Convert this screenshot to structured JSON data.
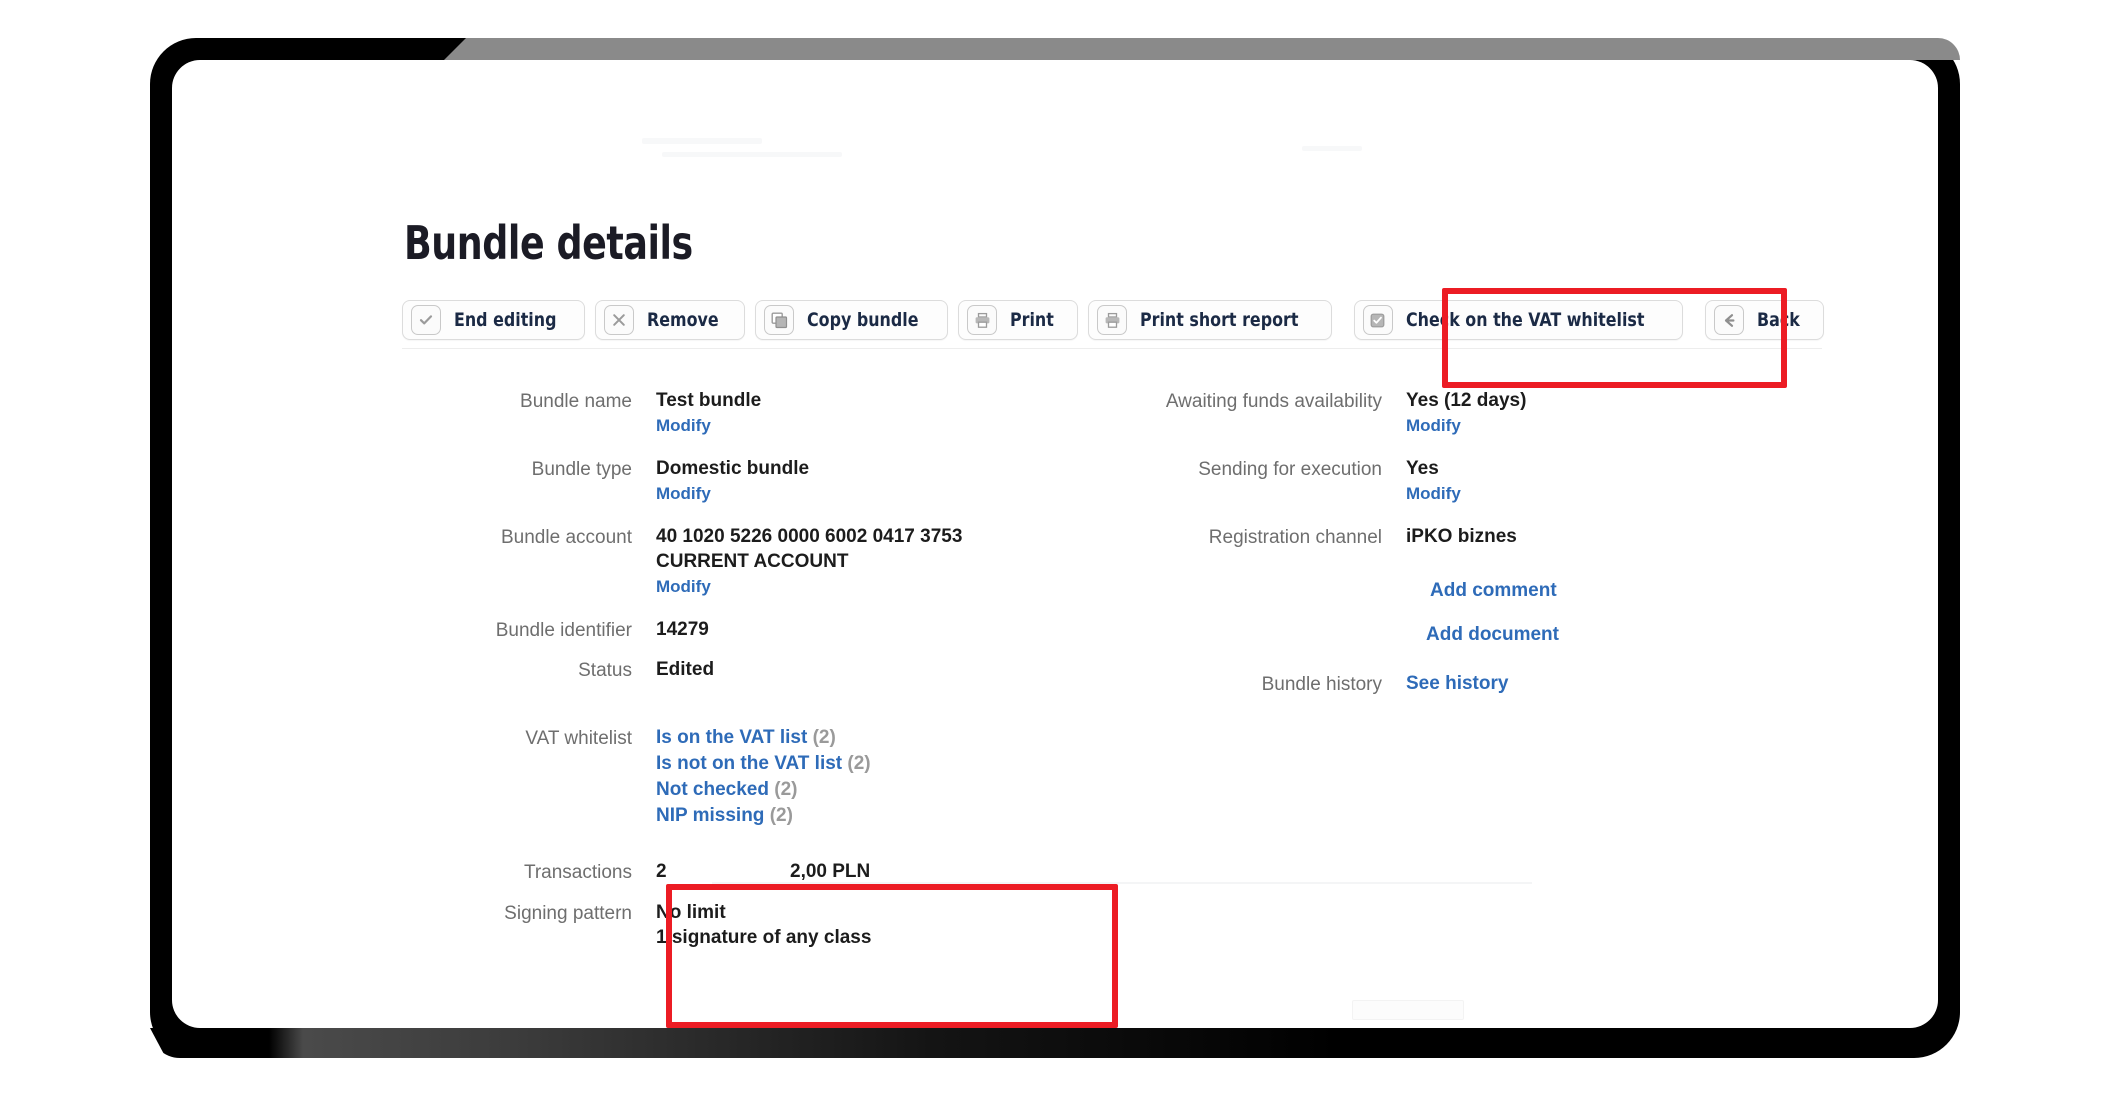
{
  "page": {
    "title": "Bundle details"
  },
  "toolbar": {
    "buttons": [
      {
        "label": "End editing",
        "icon": "check-icon"
      },
      {
        "label": "Remove",
        "icon": "close-x-icon"
      },
      {
        "label": "Copy bundle",
        "icon": "copy-icon"
      },
      {
        "label": "Print",
        "icon": "printer-icon"
      },
      {
        "label": "Print short report",
        "icon": "printer-icon"
      },
      {
        "label": "Check on the VAT whitelist",
        "icon": "checkbox-checked-icon"
      },
      {
        "label": "Back",
        "icon": "arrow-left-icon"
      }
    ]
  },
  "highlights": {
    "accent_color": "#ec1c24",
    "targets": [
      "check-on-the-vat-whitelist-button",
      "vat-whitelist-field"
    ]
  },
  "details": {
    "left": {
      "bundle_name": {
        "label": "Bundle name",
        "value": "Test bundle",
        "modify": "Modify"
      },
      "bundle_type": {
        "label": "Bundle type",
        "value": "Domestic bundle",
        "modify": "Modify"
      },
      "bundle_account": {
        "label": "Bundle account",
        "value_line1": "40 1020 5226 0000 6002 0417 3753",
        "value_line2": "CURRENT ACCOUNT",
        "modify": "Modify"
      },
      "bundle_identifier": {
        "label": "Bundle identifier",
        "value": "14279"
      },
      "status": {
        "label": "Status",
        "value": "Edited"
      },
      "vat_whitelist": {
        "label": "VAT whitelist",
        "items": [
          {
            "text": "Is on the VAT list",
            "count": "(2)"
          },
          {
            "text": "Is not on the VAT list",
            "count": "(2)"
          },
          {
            "text": "Not checked",
            "count": "(2)"
          },
          {
            "text": "NIP missing",
            "count": "(2)"
          }
        ]
      },
      "transactions": {
        "label": "Transactions",
        "count": "2",
        "amount": "2,00 PLN"
      },
      "signing_pattern": {
        "label": "Signing pattern",
        "value_line1": "No limit",
        "value_line2": "1 signature of any class"
      }
    },
    "right": {
      "awaiting_funds": {
        "label": "Awaiting funds availability",
        "value": "Yes (12 days)",
        "modify": "Modify"
      },
      "sending_for_execution": {
        "label": "Sending for execution",
        "value": "Yes",
        "modify": "Modify"
      },
      "registration_channel": {
        "label": "Registration channel",
        "value": "iPKO biznes"
      },
      "add_comment": "Add comment",
      "add_document": "Add document",
      "bundle_history": {
        "label": "Bundle history",
        "link": "See history"
      }
    }
  }
}
